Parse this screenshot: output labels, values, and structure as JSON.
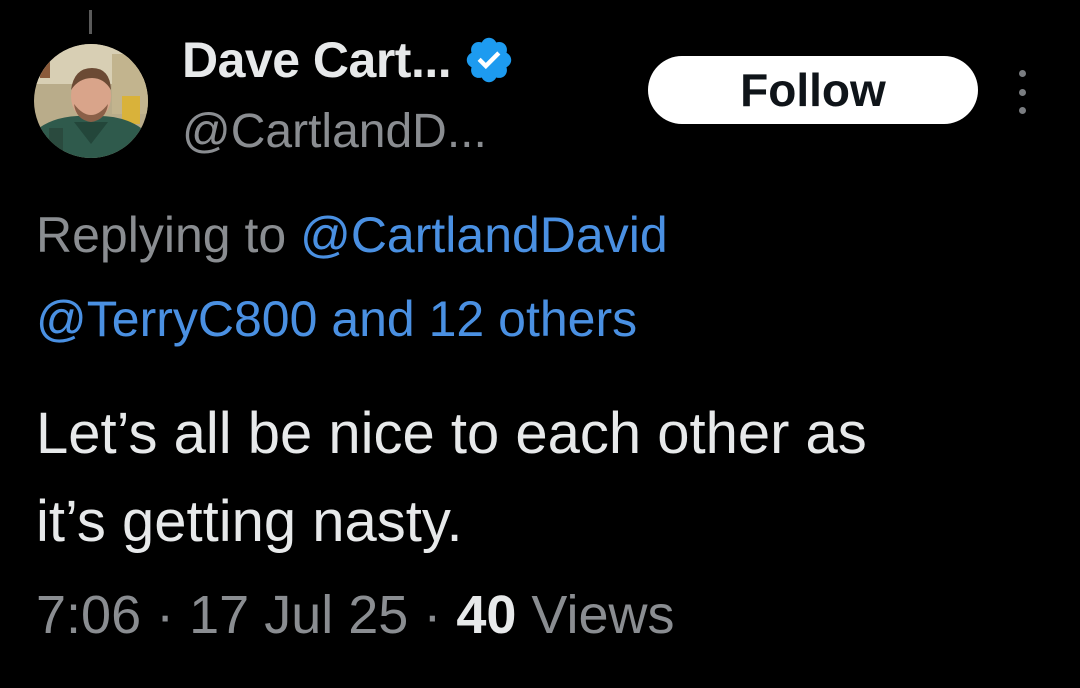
{
  "tweet": {
    "author": {
      "display_name": "Dave Cart...",
      "handle": "@CartlandD...",
      "verified": true,
      "avatar_icon": "profile-photo-avatar"
    },
    "follow_label": "Follow",
    "more_icon": "more-options-icon",
    "replying_to": {
      "prefix": "Replying to",
      "primary": "@CartlandDavid",
      "secondary": "@TerryC800",
      "others": "and 12 others"
    },
    "text_line_1": "Let’s all be nice to each other as",
    "text_line_2": "it’s getting nasty.",
    "meta": {
      "time": "7:06",
      "separator": "·",
      "date": "17 Jul 25",
      "views_count": "40",
      "views_label": "Views"
    }
  },
  "colors": {
    "background": "#000000",
    "text": "#e7e9ea",
    "muted": "#8a8d91",
    "link": "#4a90e2",
    "verified_badge": "#1d9bf0",
    "follow_button_bg": "#ffffff"
  }
}
